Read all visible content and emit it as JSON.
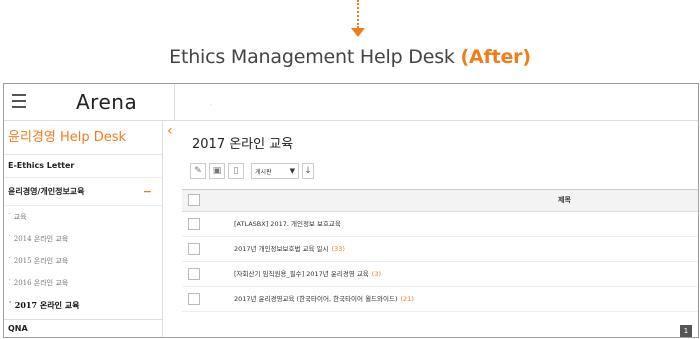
{
  "heading": {
    "main": "Ethics Management Help Desk ",
    "accent": "(After)"
  },
  "app": {
    "logo": "Arena",
    "sidebar": {
      "title": "윤리경영 Help Desk",
      "items": [
        {
          "label": "E-Ethics Letter"
        },
        {
          "label": "윤리경영/개인정보교육",
          "toggle": "−"
        }
      ],
      "subitems": [
        {
          "label": "교육"
        },
        {
          "label": "2014 온라인 교육"
        },
        {
          "label": "2015 온라인 교육"
        },
        {
          "label": "2016 온라인 교육"
        },
        {
          "label": "2017 온라인 교육"
        }
      ],
      "bottom": "QNA"
    },
    "main": {
      "title": "2017 온라인 교육",
      "toolbar": {
        "select_value": "게시판",
        "caret": "▼",
        "sort": "↓"
      },
      "table": {
        "header": "제목",
        "rows": [
          {
            "title": "[ATLASBX] 2017. 개인정보 보호교육",
            "count": ""
          },
          {
            "title": "2017년 개인정보보호법 교육 일시",
            "count": "(33)"
          },
          {
            "title": "[자회산기 임직원용_필수] 2017년 윤리경영 교육",
            "count": "(3)"
          },
          {
            "title": "2017년 윤리경영교육 (한국타이어, 한국타이어 월드와이드)",
            "count": "(21)"
          }
        ]
      },
      "pager": "1"
    }
  }
}
